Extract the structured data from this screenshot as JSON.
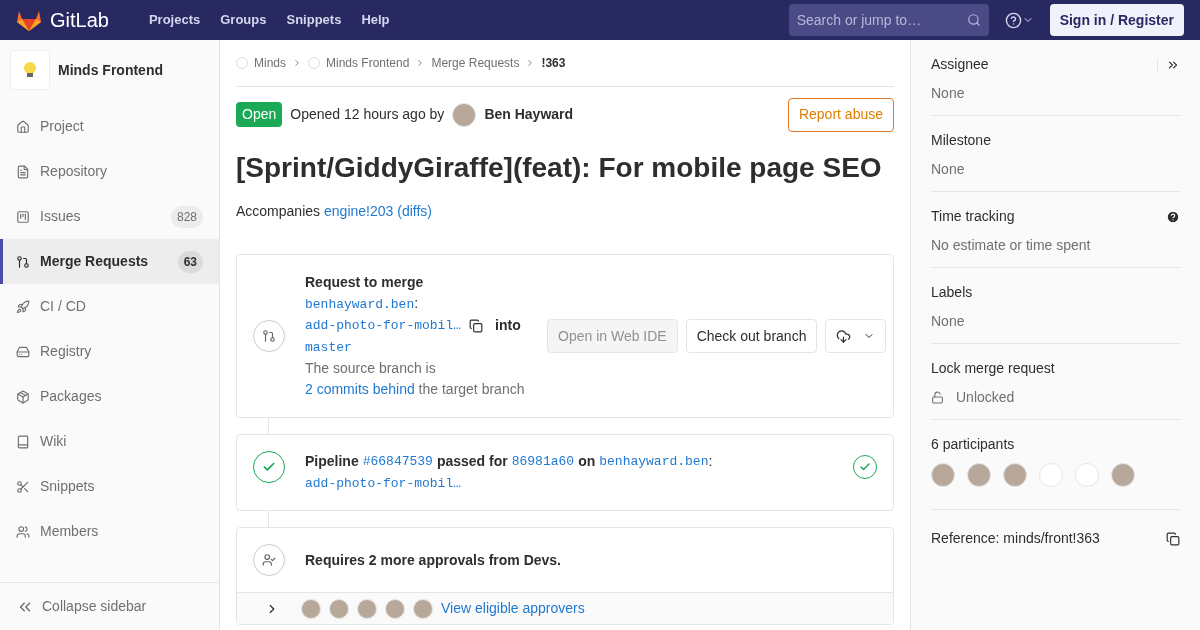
{
  "navbar": {
    "brand": "GitLab",
    "links": [
      "Projects",
      "Groups",
      "Snippets",
      "Help"
    ],
    "search": {
      "placeholder": "Search or jump to…"
    },
    "sign_in": "Sign in / Register"
  },
  "sidebar": {
    "project": "Minds Frontend",
    "items": [
      {
        "label": "Project",
        "selected": false
      },
      {
        "label": "Repository",
        "selected": false
      },
      {
        "label": "Issues",
        "count": "828",
        "selected": false
      },
      {
        "label": "Merge Requests",
        "count": "63",
        "selected": true
      },
      {
        "label": "CI / CD",
        "selected": false
      },
      {
        "label": "Registry",
        "selected": false
      },
      {
        "label": "Packages",
        "selected": false
      },
      {
        "label": "Wiki",
        "selected": false
      },
      {
        "label": "Snippets",
        "selected": false
      },
      {
        "label": "Members",
        "selected": false
      }
    ],
    "collapse": "Collapse sidebar"
  },
  "breadcrumbs": [
    "Minds",
    "Minds Frontend",
    "Merge Requests",
    "!363"
  ],
  "header": {
    "status": "Open",
    "opened": "Opened 12 hours ago by",
    "author": "Ben Hayward",
    "report": "Report abuse"
  },
  "title": "[Sprint/GiddyGiraffe](feat): For mobile page SEO",
  "description": {
    "text": "Accompanies",
    "link": "engine!203 (diffs)"
  },
  "merge_widget": {
    "title": "Request to merge",
    "source_namespace": "benhayward.ben",
    "separator": ":",
    "source_branch": "add-photo-for-mobil…",
    "into": "into",
    "target": "master",
    "status_before": "The source branch is",
    "status_link": "2 commits behind",
    "status_after": "the target branch",
    "buttons": [
      {
        "label": "Open in Web IDE",
        "disabled": true
      },
      {
        "label": "Check out branch",
        "disabled": false
      }
    ]
  },
  "pipeline": {
    "label": "Pipeline",
    "id": "#66847539",
    "passed": "passed for",
    "commit": "86981a60",
    "on": "on",
    "namespace": "benhayward.ben",
    "separator": ":",
    "branch": "add-photo-for-mobil…"
  },
  "approvals": {
    "text": "Requires 2 more approvals from Devs.",
    "approvers": [
      {
        "kind": "photo"
      },
      {
        "kind": "photo"
      },
      {
        "kind": "photo"
      },
      {
        "kind": "photo"
      },
      {
        "kind": "photo"
      }
    ],
    "link": "View eligible approvers"
  },
  "right_sidebar": {
    "sections": [
      {
        "title": "Assignee",
        "value": "None"
      },
      {
        "title": "Milestone",
        "value": "None"
      },
      {
        "title": "Time tracking",
        "value": "No estimate or time spent"
      },
      {
        "title": "Labels",
        "value": "None"
      },
      {
        "title": "Lock merge request",
        "value": "Unlocked"
      }
    ],
    "participants": {
      "title": "6 participants",
      "avatars": [
        {
          "kind": "photo"
        },
        {
          "kind": "photo"
        },
        {
          "kind": "photo"
        },
        {
          "kind": "blank"
        },
        {
          "kind": "blank"
        },
        {
          "kind": "photo"
        }
      ]
    },
    "reference": "Reference: minds/front!363"
  }
}
